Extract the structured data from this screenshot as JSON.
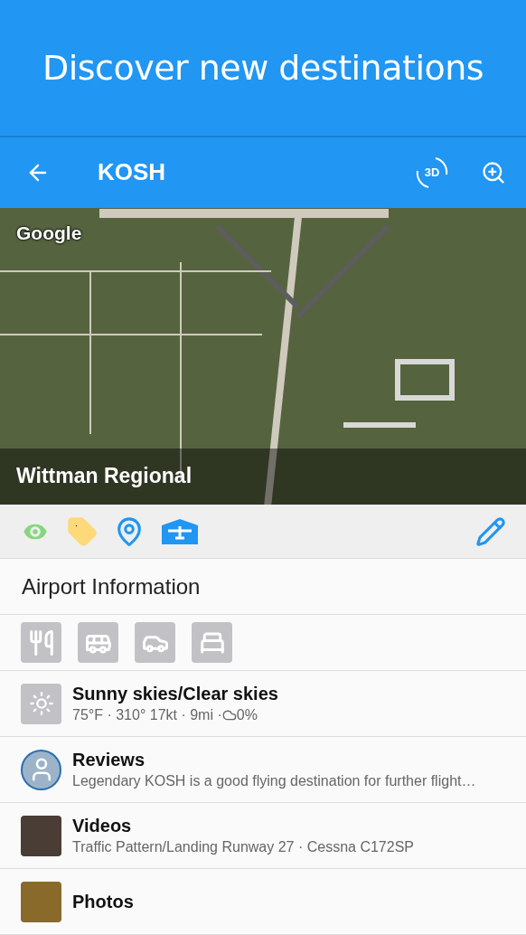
{
  "banner": {
    "title": "Discover new destinations"
  },
  "toolbar": {
    "title": "KOSH",
    "actions": [
      {
        "kind": "rotate",
        "label": "3D"
      },
      {
        "kind": "zoom"
      }
    ]
  },
  "map": {
    "attribution": "Google",
    "caption": "Wittman Regional"
  },
  "action_bar": {
    "actions": [
      {
        "kind": "eye",
        "color": "#86d67f"
      },
      {
        "kind": "tag",
        "color": "#fdd97a"
      },
      {
        "kind": "pin",
        "color": "#2196f3"
      },
      {
        "kind": "hangar",
        "color": "#2196f3"
      }
    ],
    "edit": {
      "kind": "pencil",
      "color": "#2196f3"
    }
  },
  "section": {
    "title": "Airport Information"
  },
  "amenities": [
    {
      "kind": "food"
    },
    {
      "kind": "bus"
    },
    {
      "kind": "car"
    },
    {
      "kind": "bed"
    }
  ],
  "rows": [
    {
      "kind": "weather",
      "title": "Sunny skies/Clear skies",
      "subtitle": "75°F · 310° 17kt · 9mi · ",
      "cloud_cover": "0%"
    },
    {
      "kind": "avatar",
      "title": "Reviews",
      "subtitle": "Legendary KOSH is a good flying destination for further flight…"
    },
    {
      "kind": "video",
      "title": "Videos",
      "subtitle": "Traffic Pattern/Landing Runway 27 · Cessna C172SP"
    },
    {
      "kind": "photo",
      "title": "Photos"
    }
  ]
}
